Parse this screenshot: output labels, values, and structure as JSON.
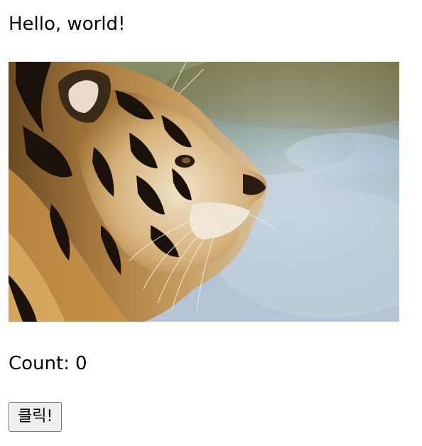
{
  "greeting": "Hello, world!",
  "image": {
    "alt": "Tiger profile",
    "icon": "tiger-photo"
  },
  "counter": {
    "label": "Count:",
    "value": "0"
  },
  "button": {
    "label": "클릭!"
  }
}
